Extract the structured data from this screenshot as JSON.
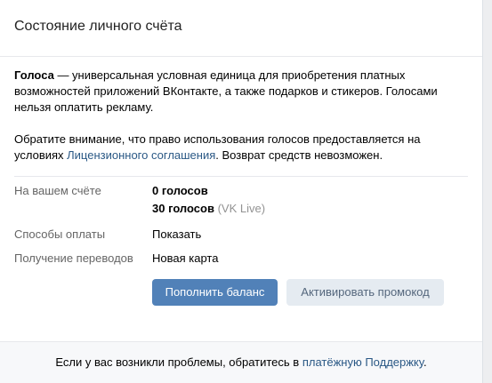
{
  "header": {
    "title": "Состояние личного счёта"
  },
  "info": {
    "term": "Голоса",
    "definition": " — универсальная условная единица для приобретения платных возможностей приложений ВКонтакте, а также подарков и стикеров. Голосами нельзя оплатить рекламу.",
    "notice_before": "Обратите внимание, что право использования голосов предоставляется на условиях ",
    "notice_link": "Лицензионного соглашения",
    "notice_after": ". Возврат средств невозможен."
  },
  "account": {
    "balance_label": "На вашем счёте",
    "balance_value": "0 голосов",
    "vk_live_value": "30 голосов",
    "vk_live_note": "(VK Live)",
    "payment_label": "Способы оплаты",
    "payment_link": "Показать",
    "transfer_label": "Получение переводов",
    "transfer_link": "Новая карта"
  },
  "buttons": {
    "top_up": "Пополнить баланс",
    "promo": "Активировать промокод"
  },
  "footer": {
    "text_before": "Если у вас возникли проблемы, обратитесь в ",
    "link": "платёжную Поддержку",
    "text_after": "."
  },
  "colors": {
    "link": "#2a5885",
    "primary_button": "#5181b8",
    "secondary_button": "#e5ebf1",
    "label_gray": "#656565"
  }
}
